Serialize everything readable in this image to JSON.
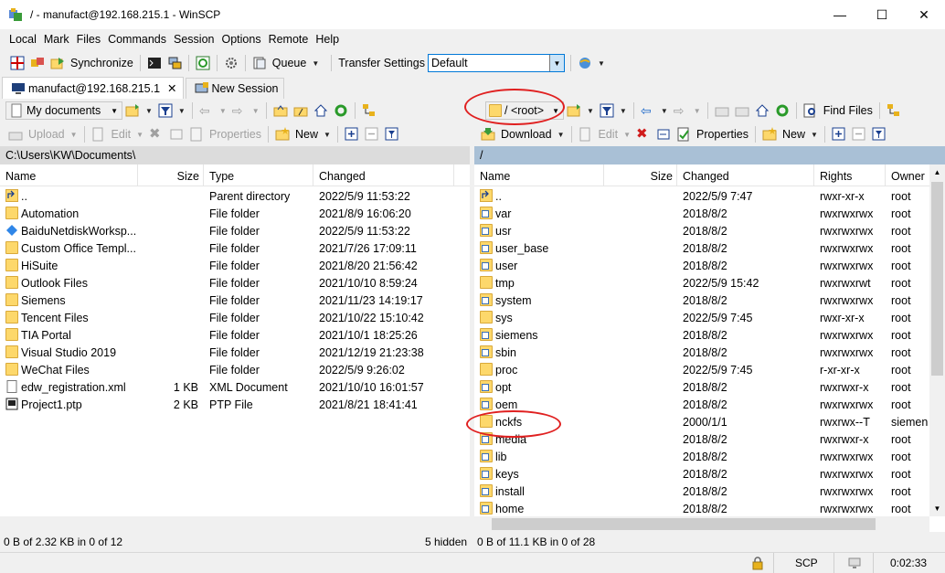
{
  "window": {
    "title": "/ - manufact@192.168.215.1 - WinSCP",
    "minimize": "—",
    "maximize": "☐",
    "close": "✕"
  },
  "menu": [
    "Local",
    "Mark",
    "Files",
    "Commands",
    "Session",
    "Options",
    "Remote",
    "Help"
  ],
  "toolbar": {
    "synchronize": "Synchronize",
    "queue": "Queue",
    "transfer_settings_label": "Transfer Settings",
    "transfer_settings_value": "Default"
  },
  "tabs": {
    "session": "manufact@192.168.215.1",
    "new_session": "New Session"
  },
  "left": {
    "location": "My documents",
    "actions": {
      "upload": "Upload",
      "edit": "Edit",
      "properties": "Properties",
      "new": "New"
    },
    "path": "C:\\Users\\KW\\Documents\\",
    "columns": [
      "Name",
      "Size",
      "Type",
      "Changed"
    ],
    "rows": [
      {
        "name": "..",
        "size": "",
        "type": "Parent directory",
        "changed": "2022/5/9  11:53:22",
        "icon": "up"
      },
      {
        "name": "Automation",
        "size": "",
        "type": "File folder",
        "changed": "2021/8/9  16:06:20",
        "icon": "folder"
      },
      {
        "name": "BaiduNetdiskWorksp...",
        "size": "",
        "type": "File folder",
        "changed": "2022/5/9  11:53:22",
        "icon": "baidu"
      },
      {
        "name": "Custom Office Templ...",
        "size": "",
        "type": "File folder",
        "changed": "2021/7/26  17:09:11",
        "icon": "folder"
      },
      {
        "name": "HiSuite",
        "size": "",
        "type": "File folder",
        "changed": "2021/8/20  21:56:42",
        "icon": "folder"
      },
      {
        "name": "Outlook Files",
        "size": "",
        "type": "File folder",
        "changed": "2021/10/10  8:59:24",
        "icon": "folder"
      },
      {
        "name": "Siemens",
        "size": "",
        "type": "File folder",
        "changed": "2021/11/23  14:19:17",
        "icon": "folder"
      },
      {
        "name": "Tencent Files",
        "size": "",
        "type": "File folder",
        "changed": "2021/10/22  15:10:42",
        "icon": "folder"
      },
      {
        "name": "TIA Portal",
        "size": "",
        "type": "File folder",
        "changed": "2021/10/1  18:25:26",
        "icon": "folder"
      },
      {
        "name": "Visual Studio 2019",
        "size": "",
        "type": "File folder",
        "changed": "2021/12/19  21:23:38",
        "icon": "folder"
      },
      {
        "name": "WeChat Files",
        "size": "",
        "type": "File folder",
        "changed": "2022/5/9  9:26:02",
        "icon": "folder"
      },
      {
        "name": "edw_registration.xml",
        "size": "1 KB",
        "type": "XML Document",
        "changed": "2021/10/10  16:01:57",
        "icon": "file"
      },
      {
        "name": "Project1.ptp",
        "size": "2 KB",
        "type": "PTP File",
        "changed": "2021/8/21  18:41:41",
        "icon": "ptp"
      }
    ],
    "status": "0 B of 2.32 KB in 0 of 12",
    "hidden": "5 hidden"
  },
  "right": {
    "location": "/ <root>",
    "find_files": "Find Files",
    "actions": {
      "download": "Download",
      "edit": "Edit",
      "properties": "Properties",
      "new": "New"
    },
    "path": "/",
    "columns": [
      "Name",
      "Size",
      "Changed",
      "Rights",
      "Owner"
    ],
    "rows": [
      {
        "name": "..",
        "size": "",
        "changed": "2022/5/9 7:47",
        "rights": "rwxr-xr-x",
        "owner": "root",
        "icon": "up"
      },
      {
        "name": "var",
        "size": "",
        "changed": "2018/8/2",
        "rights": "rwxrwxrwx",
        "owner": "root",
        "icon": "link"
      },
      {
        "name": "usr",
        "size": "",
        "changed": "2018/8/2",
        "rights": "rwxrwxrwx",
        "owner": "root",
        "icon": "link"
      },
      {
        "name": "user_base",
        "size": "",
        "changed": "2018/8/2",
        "rights": "rwxrwxrwx",
        "owner": "root",
        "icon": "link"
      },
      {
        "name": "user",
        "size": "",
        "changed": "2018/8/2",
        "rights": "rwxrwxrwx",
        "owner": "root",
        "icon": "link"
      },
      {
        "name": "tmp",
        "size": "",
        "changed": "2022/5/9 15:42",
        "rights": "rwxrwxrwt",
        "owner": "root",
        "icon": "folder"
      },
      {
        "name": "system",
        "size": "",
        "changed": "2018/8/2",
        "rights": "rwxrwxrwx",
        "owner": "root",
        "icon": "link"
      },
      {
        "name": "sys",
        "size": "",
        "changed": "2022/5/9 7:45",
        "rights": "rwxr-xr-x",
        "owner": "root",
        "icon": "folder"
      },
      {
        "name": "siemens",
        "size": "",
        "changed": "2018/8/2",
        "rights": "rwxrwxrwx",
        "owner": "root",
        "icon": "link"
      },
      {
        "name": "sbin",
        "size": "",
        "changed": "2018/8/2",
        "rights": "rwxrwxrwx",
        "owner": "root",
        "icon": "link"
      },
      {
        "name": "proc",
        "size": "",
        "changed": "2022/5/9 7:45",
        "rights": "r-xr-xr-x",
        "owner": "root",
        "icon": "folder"
      },
      {
        "name": "opt",
        "size": "",
        "changed": "2018/8/2",
        "rights": "rwxrwxr-x",
        "owner": "root",
        "icon": "link"
      },
      {
        "name": "oem",
        "size": "",
        "changed": "2018/8/2",
        "rights": "rwxrwxrwx",
        "owner": "root",
        "icon": "link"
      },
      {
        "name": "nckfs",
        "size": "",
        "changed": "2000/1/1",
        "rights": "rwxrwx--T",
        "owner": "siemen",
        "icon": "folder"
      },
      {
        "name": "media",
        "size": "",
        "changed": "2018/8/2",
        "rights": "rwxrwxr-x",
        "owner": "root",
        "icon": "link"
      },
      {
        "name": "lib",
        "size": "",
        "changed": "2018/8/2",
        "rights": "rwxrwxrwx",
        "owner": "root",
        "icon": "link"
      },
      {
        "name": "keys",
        "size": "",
        "changed": "2018/8/2",
        "rights": "rwxrwxrwx",
        "owner": "root",
        "icon": "link"
      },
      {
        "name": "install",
        "size": "",
        "changed": "2018/8/2",
        "rights": "rwxrwxrwx",
        "owner": "root",
        "icon": "link"
      },
      {
        "name": "home",
        "size": "",
        "changed": "2018/8/2",
        "rights": "rwxrwxrwx",
        "owner": "root",
        "icon": "link"
      }
    ],
    "status": "0 B of 11.1 KB in 0 of 28"
  },
  "bottom": {
    "protocol": "SCP",
    "elapsed": "0:02:33"
  },
  "colors": {
    "path_bar": "#a9c0d6",
    "folder": "#fdd86b",
    "annotation": "#e02020",
    "accent": "#0078d7"
  }
}
